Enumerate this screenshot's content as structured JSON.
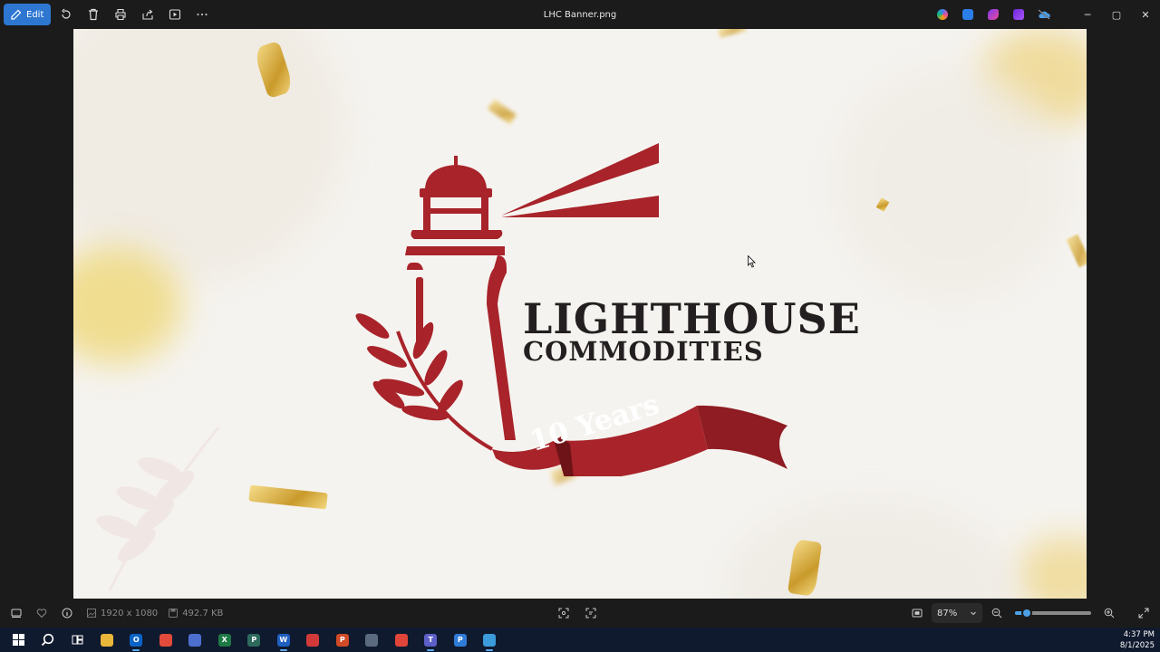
{
  "window": {
    "title": "LHC Banner.png",
    "edit_label": "Edit",
    "toolbar_icons": [
      "rotate-icon",
      "delete-icon",
      "print-icon",
      "share-icon",
      "slideshow-icon",
      "more-icon"
    ],
    "window_controls": {
      "minimize": "─",
      "maximize": "▢",
      "close": "✕"
    }
  },
  "banner": {
    "brand_line1": "LIGHTHOUSE",
    "brand_line2": "COMMODITIES",
    "ribbon_text": "10 Years",
    "colors": {
      "maroon": "#a8232a",
      "background": "#f5f3ef",
      "gold": "#d9ae45"
    }
  },
  "statusbar": {
    "dimensions": "1920 x 1080",
    "file_size": "492.7 KB",
    "zoom_label": "87%",
    "zoom_value": 0.15
  },
  "taskbar": {
    "apps": [
      {
        "name": "file-explorer",
        "glyph": "",
        "color": "#e9b73a"
      },
      {
        "name": "outlook",
        "glyph": "O",
        "color": "#0a64c8"
      },
      {
        "name": "chrome",
        "glyph": "",
        "color": "#e24b3b"
      },
      {
        "name": "app",
        "glyph": "",
        "color": "#4d6fcf"
      },
      {
        "name": "excel",
        "glyph": "X",
        "color": "#1d7a44"
      },
      {
        "name": "project",
        "glyph": "P",
        "color": "#2d6a5c"
      },
      {
        "name": "word",
        "glyph": "W",
        "color": "#1f5fbf"
      },
      {
        "name": "app",
        "glyph": "",
        "color": "#d23a3a"
      },
      {
        "name": "powerpoint",
        "glyph": "P",
        "color": "#d04a25"
      },
      {
        "name": "calculator",
        "glyph": "",
        "color": "#5a6b80"
      },
      {
        "name": "app",
        "glyph": "",
        "color": "#e0453a"
      },
      {
        "name": "teams",
        "glyph": "T",
        "color": "#5b5fc7"
      },
      {
        "name": "project",
        "glyph": "P",
        "color": "#2f7bd8"
      },
      {
        "name": "photos",
        "glyph": "",
        "color": "#3b9bdb"
      }
    ],
    "time": "4:37 PM",
    "date": "8/1/2025"
  }
}
